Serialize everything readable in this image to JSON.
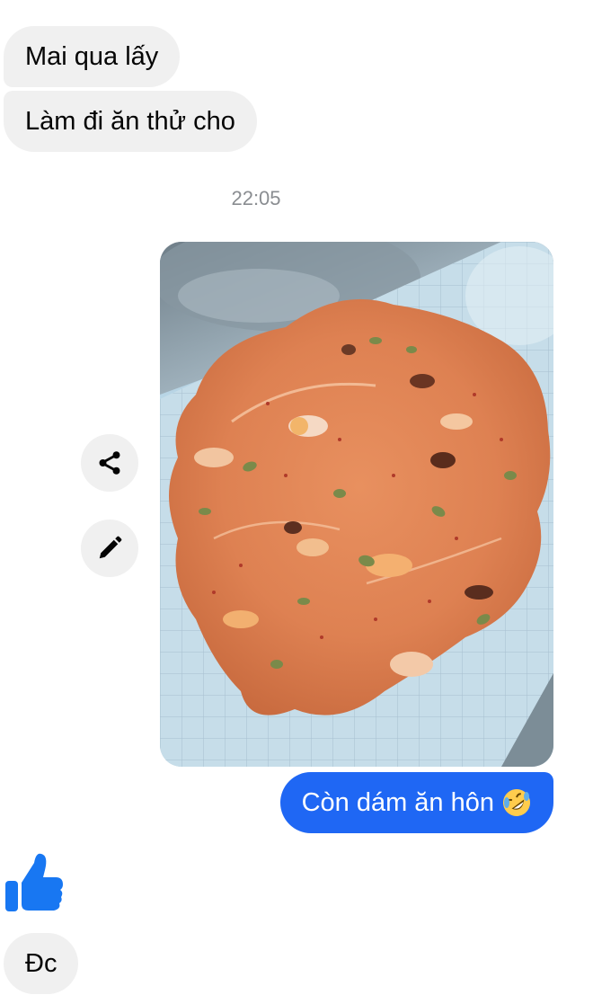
{
  "conversation": {
    "messages_in_top": [
      {
        "text": "Mai qua lấy"
      },
      {
        "text": "Làm đi ăn thử cho"
      }
    ],
    "timestamp": "22:05",
    "photo": {
      "subject": "food-photo",
      "action_icons": [
        "share-icon",
        "pencil-icon"
      ]
    },
    "message_out": {
      "text": "Còn dám ăn hôn",
      "emoji": "rolling-on-floor-laughing-emoji"
    },
    "reaction": {
      "icon": "thumbs-up-icon"
    },
    "message_in_bottom": {
      "text": "Đc"
    }
  },
  "colors": {
    "incoming_bubble": "#f0f0f0",
    "outgoing_bubble": "#1f67f4",
    "like_blue": "#1877f2",
    "timestamp_gray": "#8a8d91"
  }
}
